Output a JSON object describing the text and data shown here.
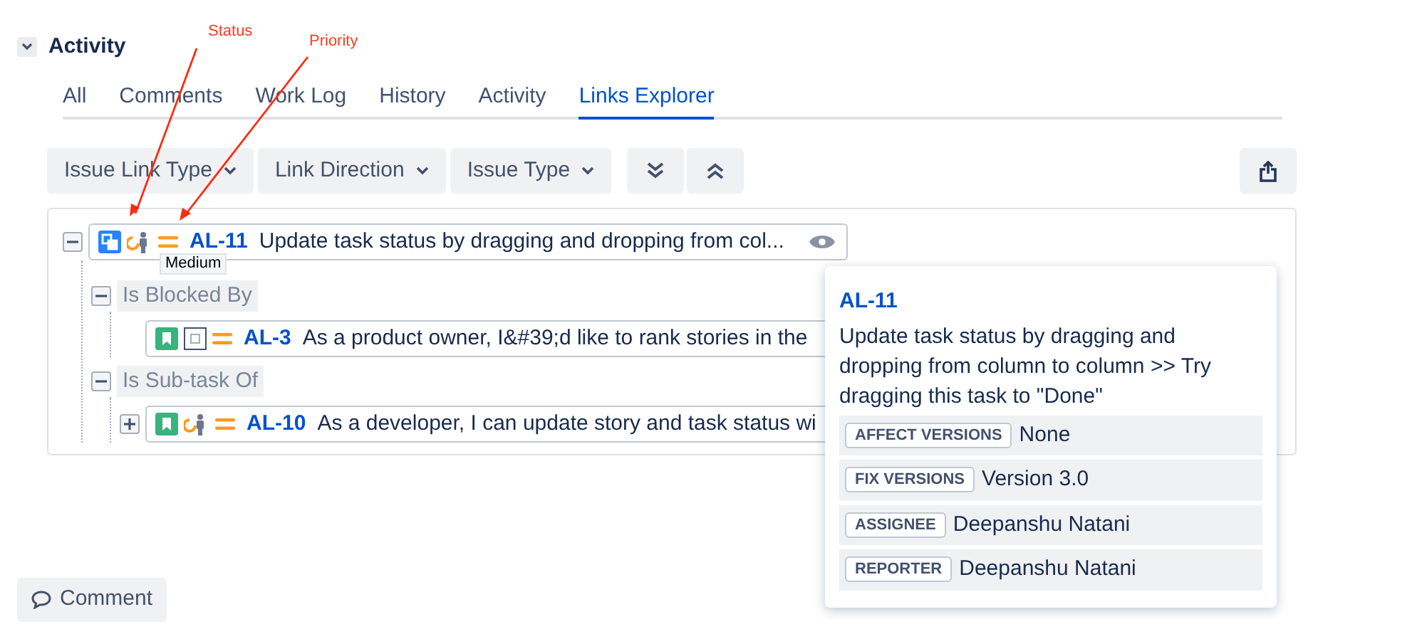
{
  "section": {
    "title": "Activity",
    "expanded": true
  },
  "tabs": [
    {
      "label": "All",
      "selected": false
    },
    {
      "label": "Comments",
      "selected": false
    },
    {
      "label": "Work Log",
      "selected": false
    },
    {
      "label": "History",
      "selected": false
    },
    {
      "label": "Activity",
      "selected": false
    },
    {
      "label": "Links Explorer",
      "selected": true
    }
  ],
  "filters": [
    "Issue Link Type",
    "Link Direction",
    "Issue Type"
  ],
  "tree": [
    {
      "kind": "issue",
      "icons": [
        {
          "kind": "subtask"
        },
        {
          "kind": "in_progress"
        },
        {
          "kind": "priority_medium"
        }
      ],
      "key": "AL-11",
      "summary": "Update task status by dragging and dropping from col...",
      "expanded": true,
      "preview_open": true,
      "children": [
        {
          "kind": "group",
          "label": "Is Blocked By",
          "expanded": true,
          "children": [
            {
              "kind": "issue",
              "icons": [
                {
                  "kind": "story"
                },
                {
                  "kind": "todo"
                },
                {
                  "kind": "priority_medium"
                }
              ],
              "key": "AL-3",
              "summary": "As a product owner, I&#39;d like to rank stories in the",
              "preview_open": false
            }
          ]
        },
        {
          "kind": "group",
          "label": "Is Sub-task Of",
          "expanded": true,
          "children": [
            {
              "kind": "issue",
              "icons": [
                {
                  "kind": "story"
                },
                {
                  "kind": "in_progress"
                },
                {
                  "kind": "priority_medium"
                }
              ],
              "key": "AL-10",
              "summary": "As a developer, I can update story and task status wi",
              "expanded": false,
              "preview_open": false
            }
          ]
        }
      ]
    }
  ],
  "priority_tooltip": "Medium",
  "popover": {
    "key": "AL-11",
    "summary": "Update task status by dragging and dropping from column to column >> Try dragging this task to \"Done\"",
    "fields": [
      {
        "label": "AFFECT VERSIONS",
        "value": "None"
      },
      {
        "label": "FIX VERSIONS",
        "value": "Version 3.0"
      },
      {
        "label": "ASSIGNEE",
        "value": "Deepanshu Natani"
      },
      {
        "label": "REPORTER",
        "value": "Deepanshu Natani"
      }
    ]
  },
  "annotations": [
    {
      "text": "Status"
    },
    {
      "text": "Priority"
    }
  ],
  "comment_button": "Comment"
}
